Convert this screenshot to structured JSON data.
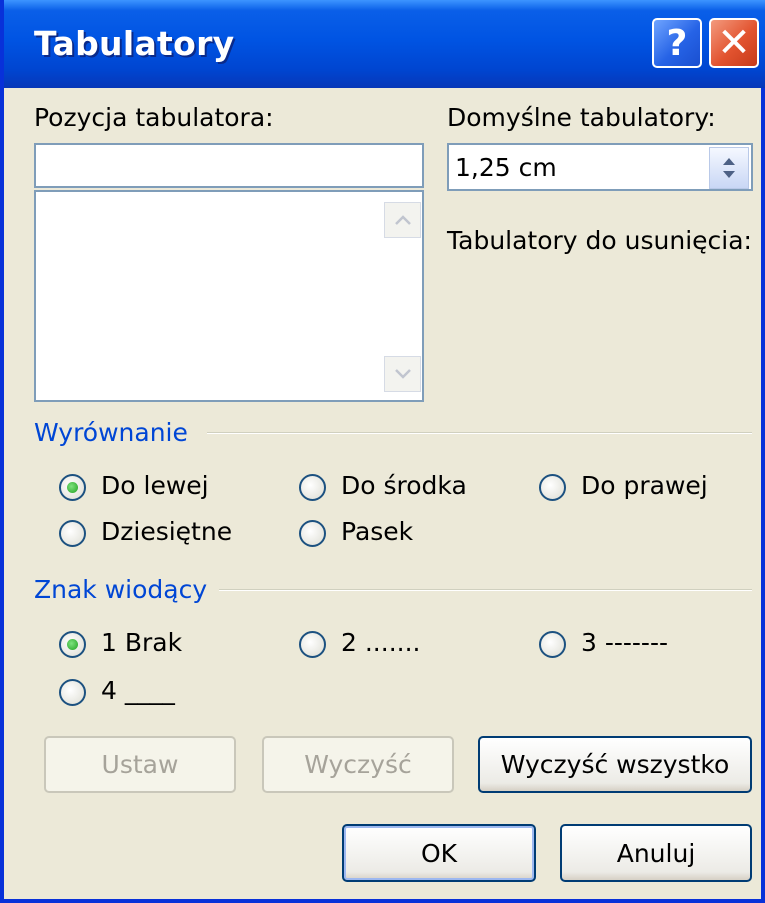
{
  "window": {
    "title": "Tabulatory"
  },
  "title_buttons": {
    "help": "?",
    "close": "✕"
  },
  "tab_position": {
    "label": "Pozycja tabulatora:",
    "value": "",
    "list": []
  },
  "default_tabs": {
    "label": "Domyślne tabulatory:",
    "value": "1,25 cm"
  },
  "to_clear": {
    "label": "Tabulatory do usunięcia:"
  },
  "alignment": {
    "title": "Wyrównanie",
    "options": [
      {
        "label": "Do lewej",
        "checked": true
      },
      {
        "label": "Do środka",
        "checked": false
      },
      {
        "label": "Do prawej",
        "checked": false
      },
      {
        "label": "Dziesiętne",
        "checked": false
      },
      {
        "label": "Pasek",
        "checked": false
      }
    ]
  },
  "leader": {
    "title": "Znak wiodący",
    "options": [
      {
        "label": "1 Brak",
        "checked": true
      },
      {
        "label": "2 .......",
        "checked": false
      },
      {
        "label": "3 -------",
        "checked": false
      },
      {
        "label": "4 ____",
        "checked": false
      }
    ]
  },
  "buttons": {
    "set": "Ustaw",
    "clear": "Wyczyść",
    "clear_all": "Wyczyść wszystko",
    "ok": "OK",
    "cancel": "Anuluj"
  },
  "colors": {
    "title_bar": "#0054e3",
    "group_title": "#0046d5",
    "dialog_bg": "#ece9d8",
    "radio_dot": "#21a121"
  }
}
